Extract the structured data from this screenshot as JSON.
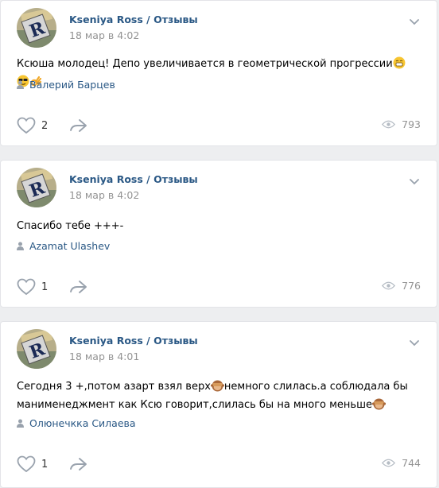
{
  "posts": [
    {
      "author": "Kseniya Ross / Отзывы",
      "date": "18 мар в 4:02",
      "text_parts": [
        "Ксюша молодец! Депо увеличивается в геометрической прогрессии"
      ],
      "emojis": [
        "grinning-face",
        "smiling-face-with-sunglasses",
        "ok-hand"
      ],
      "signer": "Валерий Барцев",
      "likes": "2",
      "views": "793"
    },
    {
      "author": "Kseniya Ross / Отзывы",
      "date": "18 мар в 4:02",
      "text_parts": [
        "Спасибо тебе +++-"
      ],
      "signer": "Azamat Ulashev",
      "likes": "1",
      "views": "776"
    },
    {
      "author": "Kseniya Ross / Отзывы",
      "date": "18 мар в 4:01",
      "text_parts": [
        "Сегодня 3 +,потом азарт взял верх",
        "немного слилась.а соблюдала бы",
        "манименеджмент как Ксю говорит,слилась бы на много меньше"
      ],
      "emojis": [
        "see-no-evil-monkey"
      ],
      "signer": "Олюнечкка Силаева",
      "likes": "1",
      "views": "744"
    }
  ],
  "colors": {
    "background": "#edeef0",
    "card": "#ffffff",
    "link": "#2a5885",
    "muted": "#939393",
    "icon": "#99a2ad"
  },
  "icons": [
    "avatar",
    "chevron-down-icon",
    "person-icon",
    "heart-icon",
    "share-arrow-icon",
    "eye-icon"
  ]
}
